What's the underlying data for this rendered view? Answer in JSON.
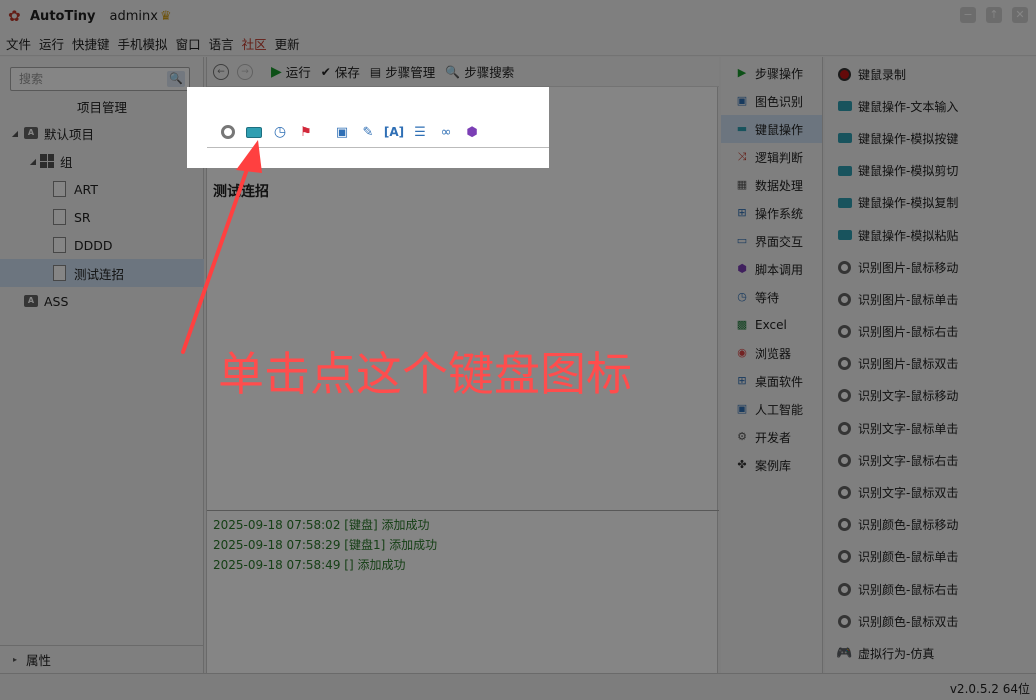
{
  "titlebar": {
    "app_title": "AutoTiny",
    "username": "adminx"
  },
  "menu": [
    "文件",
    "运行",
    "快捷键",
    "手机模拟",
    "窗口",
    "语言",
    "社区",
    "更新"
  ],
  "left": {
    "search_placeholder": "搜索",
    "pane_title": "项目管理",
    "tree": {
      "default_project": "默认项目",
      "group": "组",
      "files": [
        "ART",
        "SR",
        "DDDD",
        "测试连招"
      ],
      "ass": "ASS"
    },
    "properties": "属性"
  },
  "toolbar": {
    "run": "运行",
    "save": "保存",
    "step_manage": "步骤管理",
    "step_search": "步骤搜索"
  },
  "step": {
    "title": "测试连招"
  },
  "log": [
    "2025-09-18 07:58:02 [键盘] 添加成功",
    "2025-09-18 07:58:29 [键盘1] 添加成功",
    "2025-09-18 07:58:49 [] 添加成功"
  ],
  "categories": [
    "步骤操作",
    "图色识别",
    "键鼠操作",
    "逻辑判断",
    "数据处理",
    "操作系统",
    "界面交互",
    "脚本调用",
    "等待",
    "Excel",
    "浏览器",
    "桌面软件",
    "人工智能",
    "开发者",
    "案例库"
  ],
  "actions": [
    "键鼠录制",
    "键鼠操作-文本输入",
    "键鼠操作-模拟按键",
    "键鼠操作-模拟剪切",
    "键鼠操作-模拟复制",
    "键鼠操作-模拟粘贴",
    "识别图片-鼠标移动",
    "识别图片-鼠标单击",
    "识别图片-鼠标右击",
    "识别图片-鼠标双击",
    "识别文字-鼠标移动",
    "识别文字-鼠标单击",
    "识别文字-鼠标右击",
    "识别文字-鼠标双击",
    "识别颜色-鼠标移动",
    "识别颜色-鼠标单击",
    "识别颜色-鼠标右击",
    "识别颜色-鼠标双击",
    "虚拟行为-仿真"
  ],
  "status": {
    "version": "v2.0.5.2 64位"
  },
  "annotation": {
    "text": "单击点这个键盘图标"
  }
}
